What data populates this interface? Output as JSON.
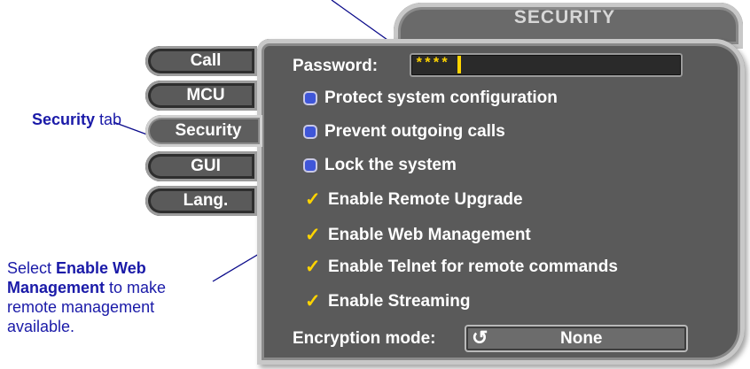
{
  "window": {
    "title": "SECURITY"
  },
  "tabs": [
    {
      "label": "Call"
    },
    {
      "label": "MCU"
    },
    {
      "label": "Security",
      "active": true
    },
    {
      "label": "GUI"
    },
    {
      "label": "Lang."
    }
  ],
  "password": {
    "label": "Password:",
    "value": "****"
  },
  "options": [
    {
      "label": "Protect system configuration",
      "type": "radio"
    },
    {
      "label": "Prevent outgoing calls",
      "type": "radio"
    },
    {
      "label": "Lock the system",
      "type": "radio"
    },
    {
      "label": "Enable Remote Upgrade",
      "type": "check",
      "checked": true
    },
    {
      "label": "Enable Web Management",
      "type": "check",
      "checked": true
    },
    {
      "label": "Enable Telnet for remote commands",
      "type": "check",
      "checked": true
    },
    {
      "label": "Enable Streaming",
      "type": "check",
      "checked": true
    }
  ],
  "encryption": {
    "label": "Encryption mode:",
    "value": "None"
  },
  "annotations": {
    "security_tab": {
      "bold": "Security",
      "rest": " tab"
    },
    "web_mgmt": {
      "pre": "Select ",
      "bold1": "Enable Web",
      "bold2": "Management",
      "post1": " to make",
      "line3": "remote management",
      "line4": "available."
    }
  },
  "colors": {
    "panel": "#5a5a5a",
    "check": "#ffd400",
    "radio": "#3f56d8",
    "annotation": "#1a1aa8"
  }
}
